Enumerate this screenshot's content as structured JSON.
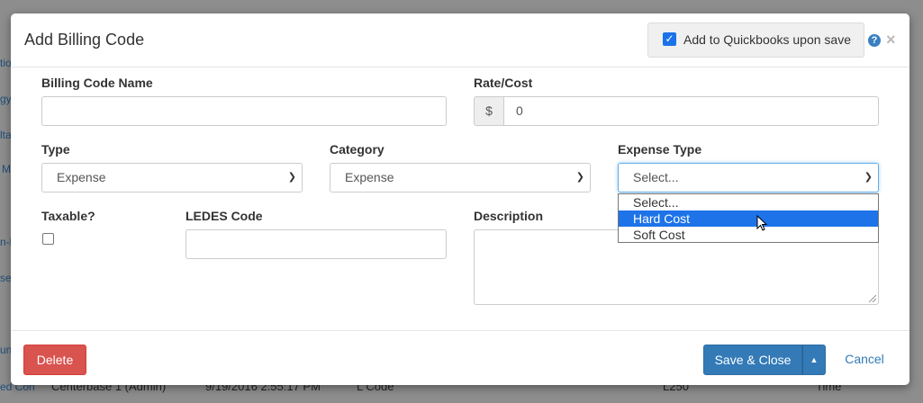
{
  "background": {
    "fragments": [
      "tio",
      "gy",
      "lta",
      "M",
      "n-l",
      "se",
      "un",
      "ed Con"
    ],
    "footer_row": {
      "col1": "Centerbase 1 (Admin)",
      "col2": "9/19/2016 2:55:17 PM",
      "col3": "L Code",
      "col4": "L250",
      "col5": "Time"
    }
  },
  "modal": {
    "title": "Add Billing Code",
    "quickbooks_label": "Add to Quickbooks upon save",
    "quickbooks_checked": true,
    "help_icon": "?",
    "close_icon": "×"
  },
  "form": {
    "billing_code_name": {
      "label": "Billing Code Name",
      "value": ""
    },
    "rate_cost": {
      "label": "Rate/Cost",
      "addon": "$",
      "value": "0"
    },
    "type": {
      "label": "Type",
      "value": "Expense"
    },
    "category": {
      "label": "Category",
      "value": "Expense"
    },
    "expense_type": {
      "label": "Expense Type",
      "value": "Select...",
      "options": [
        "Select...",
        "Hard Cost",
        "Soft Cost"
      ],
      "highlighted": "Hard Cost"
    },
    "taxable": {
      "label": "Taxable?",
      "checked": false
    },
    "ledes_code": {
      "label": "LEDES Code",
      "value": ""
    },
    "description": {
      "label": "Description",
      "value": ""
    }
  },
  "footer": {
    "delete_label": "Delete",
    "save_label": "Save & Close",
    "caret_icon": "▲",
    "cancel_label": "Cancel"
  },
  "colors": {
    "primary": "#337ab7",
    "danger": "#d9534f",
    "highlight": "#1e73e8"
  },
  "icons": {
    "select_chevron": "chevron-down-icon",
    "help": "help-icon",
    "close": "close-icon"
  }
}
